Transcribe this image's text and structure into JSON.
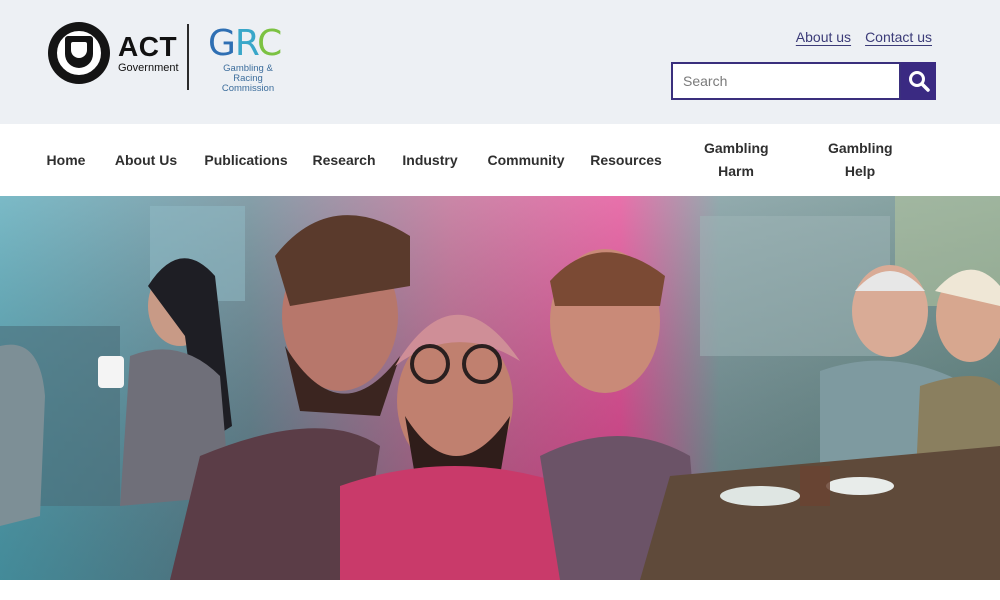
{
  "header": {
    "act_logo": {
      "title": "ACT",
      "subtitle": "Government"
    },
    "grc_logo": {
      "mark_g": "G",
      "mark_r": "R",
      "mark_c": "C",
      "subtitle": "Gambling & Racing Commission"
    },
    "top_links": [
      "About us",
      "Contact us"
    ],
    "search": {
      "placeholder": "Search"
    }
  },
  "nav": {
    "items": [
      {
        "label": "Home"
      },
      {
        "label": "About Us"
      },
      {
        "label": "Publications"
      },
      {
        "label": "Research"
      },
      {
        "label": "Industry"
      },
      {
        "label": "Community"
      },
      {
        "label": "Resources"
      },
      {
        "label": "Gambling Harm"
      },
      {
        "label": "Gambling Help"
      }
    ]
  },
  "colors": {
    "header_bg": "#edf0f4",
    "brand_purple": "#3a2a82",
    "link_color": "#3b3b78",
    "hero_overlay": "#e0428f"
  }
}
